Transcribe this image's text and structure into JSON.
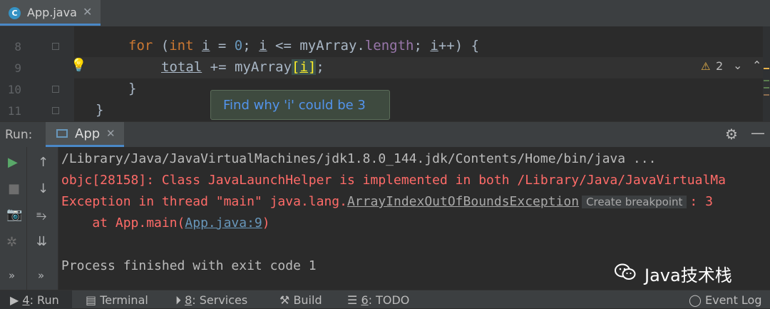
{
  "editor_tab": {
    "label": "App.java",
    "icon": "c-class-icon"
  },
  "editor": {
    "line_numbers": [
      "8",
      "9",
      "10",
      "11"
    ],
    "lines": {
      "l8": {
        "kw_for": "for",
        "p1": " (",
        "kw_int": "int",
        "v1": " ",
        "i1": "i",
        "p2": " = ",
        "zero": "0",
        "p3": "; ",
        "i2": "i",
        "p4": " <= myArray.",
        "length": "length",
        "p5": "; ",
        "i3": "i",
        "p6": "++) {"
      },
      "l9": {
        "total": "total",
        "p1": " += myArray",
        "br_open": "[",
        "i": "i",
        "br_close": "]",
        "p2": ";"
      },
      "l10": "}",
      "l11": "}"
    },
    "tooltip": "Find why 'i' could be 3",
    "warnings_count": "2"
  },
  "run_panel": {
    "title": "Run:",
    "tab_label": "App",
    "console": {
      "line1": "/Library/Java/JavaVirtualMachines/jdk1.8.0_144.jdk/Contents/Home/bin/java ...",
      "line2": "objc[28158]: Class JavaLaunchHelper is implemented in both /Library/Java/JavaVirtualMa",
      "line3_prefix": "Exception in thread \"main\" java.lang.",
      "line3_link": "ArrayIndexOutOfBoundsException",
      "line3_breakpoint": "Create breakpoint",
      "line3_suffix": ": 3",
      "line4_prefix": "    at App.main(",
      "line4_link": "App.java:9",
      "line4_suffix": ")",
      "line5": "Process finished with exit code 1"
    }
  },
  "watermark": "Java技术栈",
  "status_bar": {
    "run": {
      "num": "4",
      "label": ": Run"
    },
    "terminal": "Terminal",
    "services": {
      "num": "8",
      "label": ": Services"
    },
    "build": "Build",
    "todo": {
      "num": "6",
      "label": ": TODO"
    },
    "event_log": "Event Log"
  },
  "colors": {
    "background": "#2b2b2b",
    "keyword": "#cc7832",
    "number": "#6897bb",
    "field": "#9876aa",
    "error": "#ff6b68",
    "tooltip_text": "#5394ec",
    "accent": "#4a88c7"
  }
}
